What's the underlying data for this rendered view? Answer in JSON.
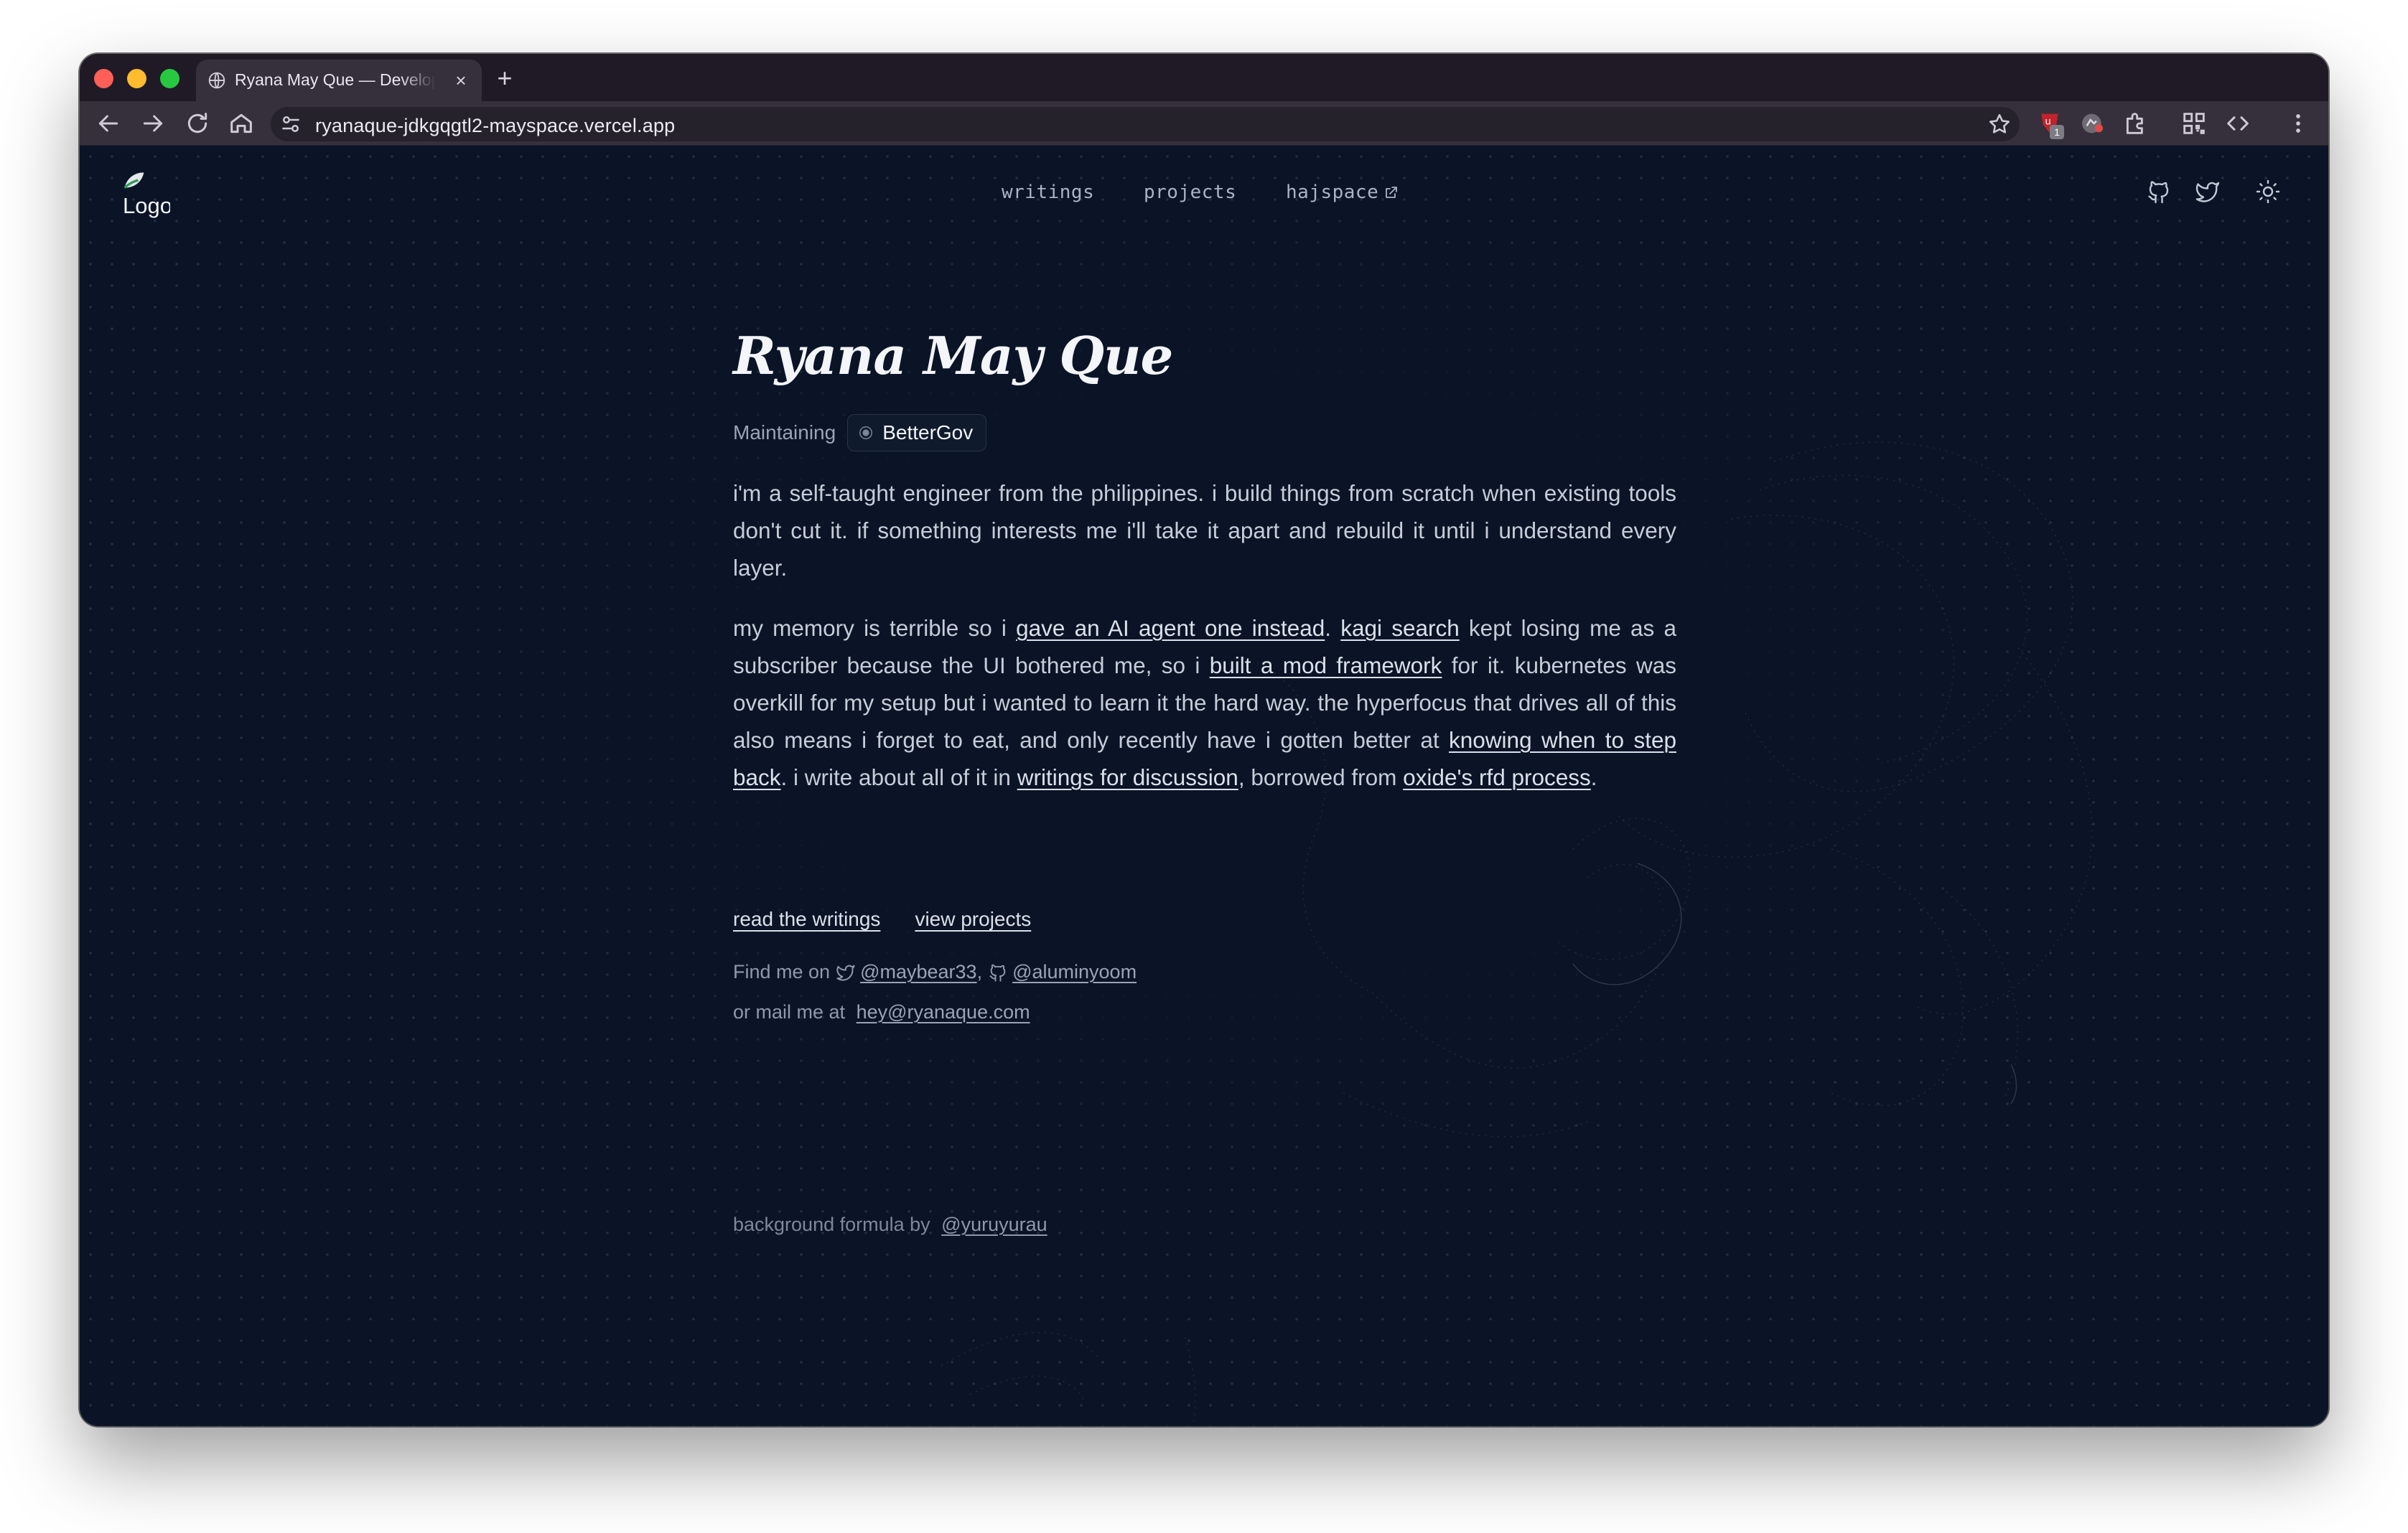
{
  "browser": {
    "tab_title": "Ryana May Que — Developer",
    "tab_close": "×",
    "new_tab": "+",
    "url": "ryanaque-jdkgqgtl2-mayspace.vercel.app",
    "extension_badge": "1"
  },
  "header": {
    "logo_alt": "Logo",
    "nav": [
      {
        "label": "writings"
      },
      {
        "label": "projects"
      },
      {
        "label": "hajspace"
      }
    ]
  },
  "hero": {
    "name": "Ryana May Que",
    "maintaining_label": "Maintaining",
    "project_badge": "BetterGov"
  },
  "bio": {
    "p1": "i'm a self-taught engineer from the philippines. i build things from scratch when existing tools don't cut it. if something interests me i'll take it apart and rebuild it until i understand every layer.",
    "p2": {
      "t1": "my memory is terrible so i ",
      "link1": "gave an AI agent one instead",
      "t2": ". ",
      "link2": "kagi search",
      "t3": " kept losing me as a subscriber because the UI bothered me, so i ",
      "link3": "built a mod framework",
      "t4": " for it. kubernetes was overkill for my setup but i wanted to learn it the hard way. the hyperfocus that drives all of this also means i forget to eat, and only recently have i gotten better at ",
      "link4": "knowing when to step back",
      "t5": ". i write about all of it in ",
      "link5": "writings for discussion",
      "t6": ", borrowed from ",
      "link6": "oxide's rfd process",
      "t7": "."
    }
  },
  "cta": {
    "writings": "read the writings",
    "projects": "view projects"
  },
  "contact": {
    "find_label": "Find me on",
    "twitter": "@maybear33",
    "separator": ",",
    "github": "@aluminyoom",
    "mail_label": "or mail me at",
    "email": "hey@ryanaque.com"
  },
  "footer": {
    "label": "background formula by",
    "credit": "@yuruyurau"
  },
  "colors": {
    "background": "#0b1427",
    "text": "#c6cdd8",
    "heading": "#f3f5f9",
    "muted": "#8f99aa"
  },
  "icons": [
    "globe-icon",
    "back-arrow-icon",
    "forward-arrow-icon",
    "reload-icon",
    "home-icon",
    "tune-icon",
    "star-icon",
    "extension-icon",
    "puzzle-icon",
    "qr-icon",
    "code-icon",
    "kebab-icon",
    "github-icon",
    "twitter-icon",
    "sun-icon",
    "external-link-icon"
  ]
}
